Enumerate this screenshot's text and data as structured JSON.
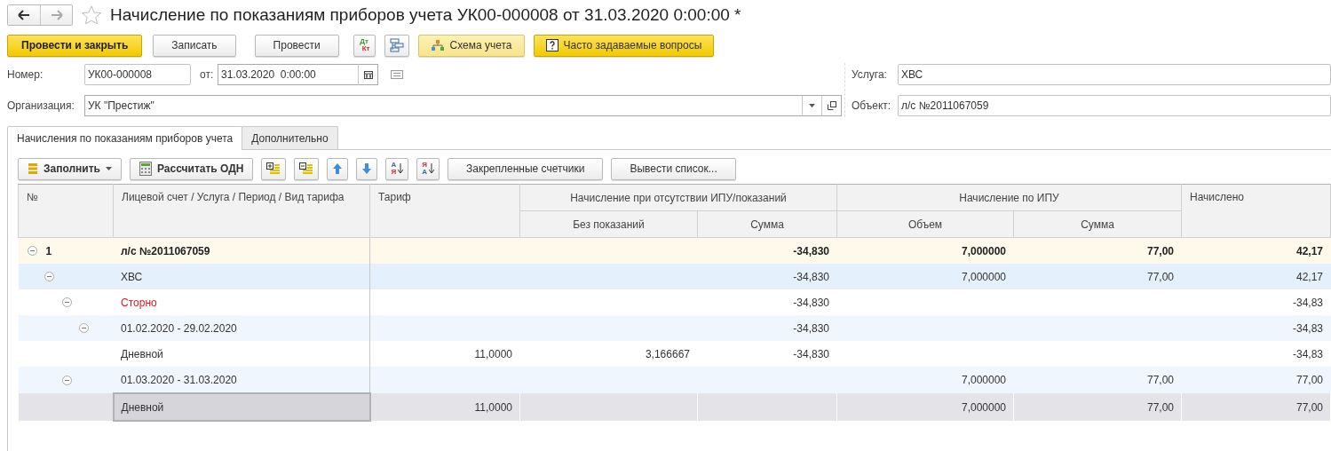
{
  "window": {
    "title": "Начисление по показаниям приборов учета УК00-000008 от 31.03.2020 0:00:00 *",
    "favorite": false
  },
  "toolbar": [
    {
      "kind": "primary",
      "label": "Провести и закрыть"
    },
    {
      "kind": "plain",
      "label": "Записать"
    },
    {
      "kind": "plain",
      "label": "Провести"
    },
    {
      "kind": "dtkt",
      "top": "Дт",
      "bottom": "Кт"
    },
    {
      "kind": "structure"
    },
    {
      "kind": "scheme",
      "label": "Схема учета"
    },
    {
      "kind": "help",
      "label": "Часто задаваемые вопросы"
    }
  ],
  "fields": {
    "number": {
      "label": "Номер:",
      "value": "УК00-000008"
    },
    "date": {
      "label": "от:",
      "value": "31.03.2020  0:00:00"
    },
    "organization": {
      "label": "Организация:",
      "value": "УК \"Престиж\""
    },
    "service": {
      "label": "Услуга:",
      "value": "ХВС"
    },
    "object": {
      "label": "Объект:",
      "value": "л/с №2011067059"
    }
  },
  "tabs": [
    {
      "label": "Начисления по показаниям приборов учета",
      "selected": true
    },
    {
      "label": "Дополнительно",
      "selected": false
    }
  ],
  "table_toolbar": [
    {
      "kind": "fill",
      "label": "Заполнить"
    },
    {
      "kind": "calc",
      "label": "Рассчитать ОДН"
    },
    {
      "kind": "expand"
    },
    {
      "kind": "collapse"
    },
    {
      "kind": "up"
    },
    {
      "kind": "down"
    },
    {
      "kind": "sort",
      "top": "А",
      "bottom": "Я"
    },
    {
      "kind": "sort",
      "top": "Я",
      "bottom": "А"
    },
    {
      "kind": "plain",
      "label": "Закрепленные счетчики"
    },
    {
      "kind": "plain",
      "label": "Вывести список..."
    }
  ],
  "table": {
    "columns": [
      {
        "label": "№"
      },
      {
        "label": "Лицевой счет / Услуга / Период / Вид тарифа"
      },
      {
        "label": "Тариф"
      },
      {
        "label": "Начисление при отсутствии ИПУ/показаний",
        "children": [
          {
            "label": "Без показаний"
          },
          {
            "label": "Сумма"
          }
        ]
      },
      {
        "label": "Начисление по ИПУ",
        "children": [
          {
            "label": "Объем"
          },
          {
            "label": "Сумма"
          }
        ]
      },
      {
        "label": "Начислено"
      }
    ],
    "rows": [
      {
        "kind": "account",
        "number": "1",
        "text": "л/с №2011067059",
        "expanded": true,
        "selected": false,
        "values": {
          "sum_no_meter": "-34,830",
          "volume": "7,000000",
          "sum_meter": "77,00",
          "charged": "42,17"
        },
        "children": [
          {
            "kind": "service",
            "text": "ХВС",
            "expanded": true,
            "selected": false,
            "values": {
              "sum_no_meter": "-34,830",
              "volume": "7,000000",
              "sum_meter": "77,00",
              "charged": "42,17"
            },
            "children": [
              {
                "kind": "storno",
                "text": "Сторно",
                "expanded": true,
                "selected": false,
                "values": {
                  "sum_no_meter": "-34,830",
                  "charged": "-34,83"
                },
                "children": [
                  {
                    "kind": "plain",
                    "text": "01.02.2020 - 29.02.2020",
                    "expanded": true,
                    "selected": false,
                    "values": {
                      "sum_no_meter": "-34,830",
                      "charged": "-34,83"
                    },
                    "children": [
                      {
                        "kind": "plain",
                        "text": "Дневной",
                        "selected": false,
                        "values": {
                          "tariff": "11,0000",
                          "no_reading": "3,166667",
                          "sum_no_meter": "-34,830",
                          "charged": "-34,83"
                        }
                      }
                    ]
                  }
                ]
              },
              {
                "kind": "plain",
                "text": "01.03.2020 - 31.03.2020",
                "expanded": true,
                "selected": false,
                "values": {
                  "volume": "7,000000",
                  "sum_meter": "77,00",
                  "charged": "77,00"
                },
                "children": [
                  {
                    "kind": "plain",
                    "text": "Дневной",
                    "selected": true,
                    "values": {
                      "tariff": "11,0000",
                      "volume": "7,000000",
                      "sum_meter": "77,00",
                      "charged": "77,00"
                    }
                  }
                ]
              }
            ]
          }
        ]
      }
    ]
  }
}
